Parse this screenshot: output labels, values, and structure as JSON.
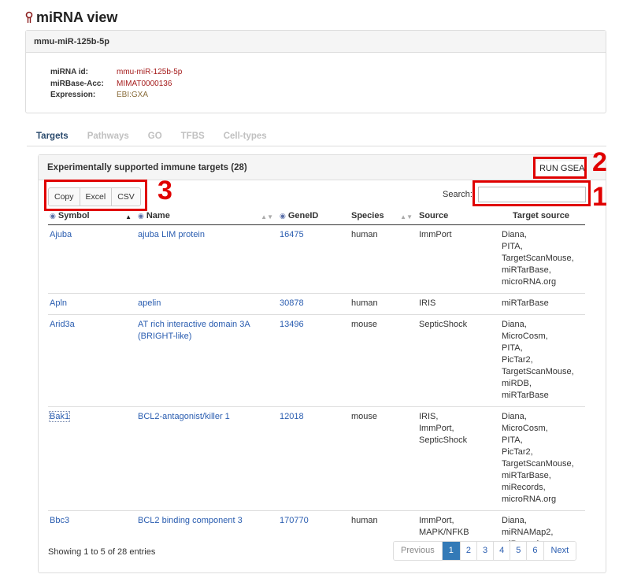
{
  "page": {
    "title": "miRNA view",
    "icon": "mirna-hairpin-icon"
  },
  "mirna": {
    "heading": "mmu-miR-125b-5p",
    "fields": [
      {
        "label": "miRNA id:",
        "value": "mmu-miR-125b-5p"
      },
      {
        "label": "miRBase-Acc:",
        "value": "MIMAT0000136"
      },
      {
        "label": "Expression:",
        "value": "EBI:GXA"
      }
    ]
  },
  "tabs": [
    {
      "label": "Targets",
      "active": true
    },
    {
      "label": "Pathways",
      "active": false
    },
    {
      "label": "GO",
      "active": false
    },
    {
      "label": "TFBS",
      "active": false
    },
    {
      "label": "Cell-types",
      "active": false
    }
  ],
  "targets": {
    "heading": "Experimentally supported immune targets (28)",
    "gsea_label": "RUN GSEA",
    "export_buttons": [
      "Copy",
      "Excel",
      "CSV"
    ],
    "search_label": "Search:",
    "search_value": "",
    "columns": [
      "Symbol",
      "Name",
      "GeneID",
      "Species",
      "Source",
      "Target source"
    ],
    "rows": [
      {
        "symbol": "Ajuba",
        "name": "ajuba LIM protein",
        "gene_id": "16475",
        "species": "human",
        "source": [
          "ImmPort"
        ],
        "target_source": [
          "Diana,",
          "PITA,",
          "TargetScanMouse,",
          "miRTarBase,",
          "microRNA.org"
        ]
      },
      {
        "symbol": "Apln",
        "name": "apelin",
        "gene_id": "30878",
        "species": "human",
        "source": [
          "IRIS"
        ],
        "target_source": [
          "miRTarBase"
        ]
      },
      {
        "symbol": "Arid3a",
        "name": "AT rich interactive domain 3A (BRIGHT-like)",
        "gene_id": "13496",
        "species": "mouse",
        "source": [
          "SepticShock"
        ],
        "target_source": [
          "Diana,",
          "MicroCosm,",
          "PITA,",
          "PicTar2,",
          "TargetScanMouse,",
          "miRDB,",
          "miRTarBase"
        ]
      },
      {
        "symbol": "Bak1",
        "name": "BCL2-antagonist/killer 1",
        "gene_id": "12018",
        "species": "mouse",
        "source": [
          "IRIS,",
          "ImmPort,",
          "SepticShock"
        ],
        "target_source": [
          "Diana,",
          "MicroCosm,",
          "PITA,",
          "PicTar2,",
          "TargetScanMouse,",
          "miRTarBase,",
          "miRecords,",
          "microRNA.org"
        ]
      },
      {
        "symbol": "Bbc3",
        "name": "BCL2 binding component 3",
        "gene_id": "170770",
        "species": "human",
        "source": [
          "ImmPort,",
          "MAPK/NFKB"
        ],
        "target_source": [
          "Diana,",
          "miRNAMap2,",
          "miRecords"
        ]
      }
    ],
    "info": "Showing 1 to 5 of 28 entries",
    "pagination": {
      "previous": "Previous",
      "pages": [
        "1",
        "2",
        "3",
        "4",
        "5",
        "6"
      ],
      "current": "1",
      "next": "Next"
    }
  },
  "annotations": [
    "1",
    "2",
    "3"
  ],
  "colors": {
    "annotation": "#e00000",
    "link": "#2a5db0",
    "active_page": "#337ab7",
    "mirna_value": "#a51c1c"
  }
}
